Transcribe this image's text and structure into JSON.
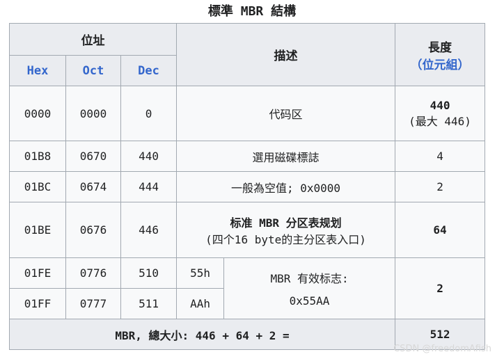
{
  "caption": "標準 MBR 結構",
  "header": {
    "address": "位址",
    "hex": "Hex",
    "oct": "Oct",
    "dec": "Dec",
    "description": "描述",
    "length_line1": "長度",
    "length_line2": "（位元組）"
  },
  "rows": [
    {
      "hex": "0000",
      "oct": "0000",
      "dec": "0",
      "desc": "代码区",
      "len1": "440",
      "len2": "(最大 446)"
    },
    {
      "hex": "01B8",
      "oct": "0670",
      "dec": "440",
      "desc": "選用磁碟標誌",
      "len": "4"
    },
    {
      "hex": "01BC",
      "oct": "0674",
      "dec": "444",
      "desc": "一般為空值; 0x0000",
      "len": "2"
    },
    {
      "hex": "01BE",
      "oct": "0676",
      "dec": "446",
      "desc1": "标准 MBR 分区表规划",
      "desc2": "(四个16 byte的主分区表入口)",
      "len": "64"
    },
    {
      "hex": "01FE",
      "oct": "0776",
      "dec": "510",
      "val": "55h"
    },
    {
      "hex": "01FF",
      "oct": "0777",
      "dec": "511",
      "val": "AAh"
    }
  ],
  "signature": {
    "desc1": "MBR 有效标志:",
    "desc2": "0x55AA",
    "len": "2"
  },
  "footer": {
    "label": "MBR, 總大小: 446 + 64 + 2 =",
    "value": "512"
  },
  "watermark": "CSDN @freedomAfish"
}
